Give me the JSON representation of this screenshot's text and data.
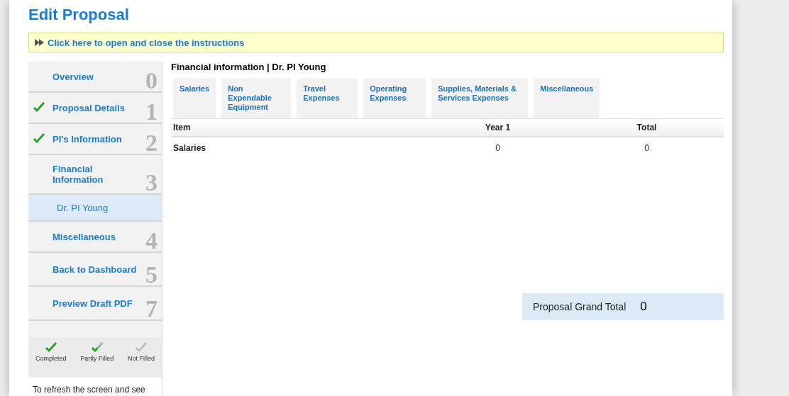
{
  "page_title": "Edit Proposal",
  "instructions": {
    "label": "Click here to open and close the instructions",
    "expanded": false
  },
  "sidebar": {
    "items": [
      {
        "label": "Overview",
        "number": "0",
        "completed": false
      },
      {
        "label": "Proposal Details",
        "number": "1",
        "completed": true
      },
      {
        "label": "PI's Information",
        "number": "2",
        "completed": true
      },
      {
        "label": "Financial Information",
        "number": "3",
        "completed": false,
        "children": [
          {
            "label": "Dr. PI Young",
            "selected": true
          }
        ]
      },
      {
        "label": "Miscellaneous",
        "number": "4",
        "completed": false
      },
      {
        "label": "Back to Dashboard",
        "number": "5",
        "completed": false
      },
      {
        "label": "Preview Draft PDF",
        "number": "7",
        "completed": false
      }
    ],
    "legend": [
      {
        "kind": "completed",
        "label": "Completed"
      },
      {
        "kind": "partly",
        "label": "Partly Filled"
      },
      {
        "kind": "not",
        "label": "Not Filled"
      }
    ],
    "note": "To refresh the screen and see"
  },
  "section_title": "Financial information | Dr. PI Young",
  "tabs": [
    {
      "label": "Salaries",
      "selected": false
    },
    {
      "label": "Non Expendable Equipment",
      "selected": false
    },
    {
      "label": "Travel Expenses",
      "selected": false
    },
    {
      "label": "Operating Expenses",
      "selected": false
    },
    {
      "label": "Supplies, Materials & Services Expenses",
      "selected": false
    },
    {
      "label": "Miscellaneous",
      "selected": false
    }
  ],
  "table": {
    "columns": [
      "Item",
      "Year 1",
      "Total"
    ],
    "rows": [
      [
        "Salaries",
        "0",
        "0"
      ]
    ]
  },
  "grand_total": {
    "label": "Proposal Grand Total",
    "value": "0"
  }
}
